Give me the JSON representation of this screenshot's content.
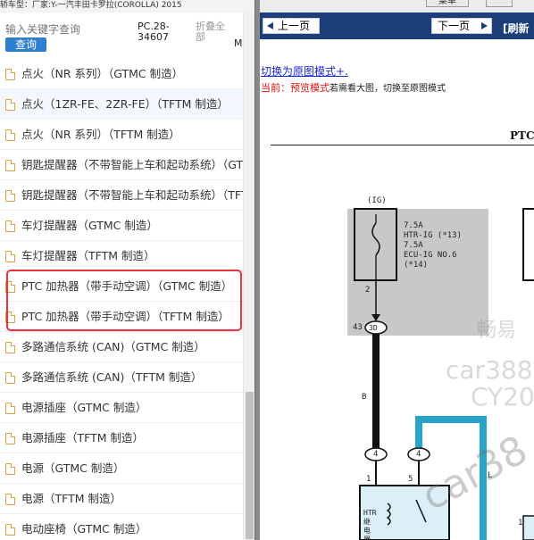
{
  "top_strip": {
    "model_line": "轿车型：厂家:Y-一汽丰田卡罗拉(COROLLA) 2015",
    "menu_label": "菜单"
  },
  "search": {
    "placeholder": "输入关键字查询",
    "button_label": "查询",
    "pc_number": "PC.28-34607",
    "fold_all": "折叠全部",
    "m_label": "M"
  },
  "list": {
    "items": [
      {
        "label": "点火（NR 系列）（GTMC 制造）"
      },
      {
        "label": "点火（1ZR-FE、2ZR-FE）（TFTM 制造）"
      },
      {
        "label": "点火（NR 系列）（TFTM 制造）"
      },
      {
        "label": "钥匙提醒器（不带智能上车和起动系统）（GTMC 制造）"
      },
      {
        "label": "钥匙提醒器（不带智能上车和起动系统）（TFTM 制造）"
      },
      {
        "label": "车灯提醒器（GTMC 制造）"
      },
      {
        "label": "车灯提醒器（TFTM 制造）"
      },
      {
        "label": "PTC 加热器（带手动空调）（GTMC 制造）"
      },
      {
        "label": "PTC 加热器（带手动空调）（TFTM 制造）"
      },
      {
        "label": "多路通信系统 (CAN)（GTMC 制造）"
      },
      {
        "label": "多路通信系统 (CAN)（TFTM 制造）"
      },
      {
        "label": "电源插座（GTMC 制造）"
      },
      {
        "label": "电源插座（TFTM 制造）"
      },
      {
        "label": "电源（GTMC 制造）"
      },
      {
        "label": "电源（TFTM 制造）"
      },
      {
        "label": "电动座椅（GTMC 制造）"
      }
    ]
  },
  "viewer": {
    "prev_label": "上一页",
    "next_label": "下一页",
    "refresh_label": "[刷新",
    "switch_link": "切换为原图模式+.",
    "current_prefix": "当前：预览模式",
    "current_suffix": "若需看大图，切换至原图模式"
  },
  "diagram": {
    "title": "PTC",
    "ig_label": "(IG)",
    "fuse_1": "7.5A",
    "fuse_1_name": "HTR-IG (*13)",
    "fuse_2": "7.5A",
    "fuse_2_name": "ECU-IG NO.6",
    "fuse_2_note": "(*14)",
    "pin_2": "2",
    "pin_43": "43",
    "connector_3d": "3D",
    "wire_b": "B",
    "conn_4a": "4",
    "conn_4b": "4",
    "pin_1": "1",
    "pin_5": "5",
    "pin_l": "L",
    "relay_label": "HTR\n继电器",
    "right_pin": "1"
  },
  "watermarks": [
    "畅易",
    "car388.",
    "CY20",
    "car38"
  ],
  "colors": {
    "toolbar": "#1c3e7b",
    "highlight_box": "#e8323c",
    "search_button": "#2f7fd1",
    "wire_cyan": "#2aa3c8",
    "fuse_box": "#c8c8c8"
  }
}
